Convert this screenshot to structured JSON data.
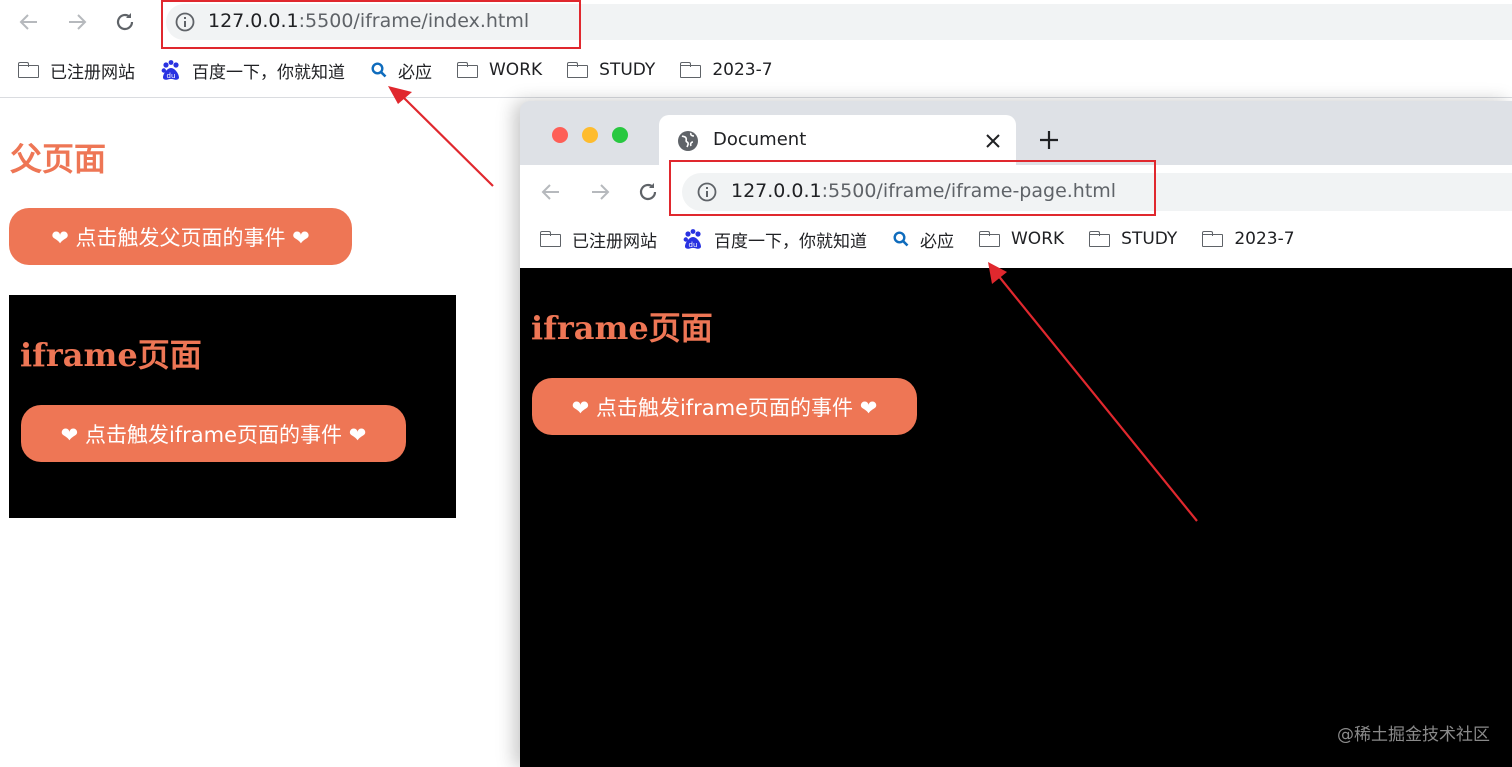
{
  "top_browser": {
    "url_host": "127.0.0.1",
    "url_path": ":5500/iframe/index.html",
    "bookmarks": [
      {
        "label": "已注册网站",
        "icon": "folder-icon"
      },
      {
        "label": "百度一下，你就知道",
        "icon": "baidu-paw-icon"
      },
      {
        "label": "必应",
        "icon": "bing-search-icon"
      },
      {
        "label": "WORK",
        "icon": "folder-icon"
      },
      {
        "label": "STUDY",
        "icon": "folder-icon"
      },
      {
        "label": "2023-7",
        "icon": "folder-icon"
      }
    ]
  },
  "parent_page": {
    "title": "父页面",
    "button_label": "❤ 点击触发父页面的事件 ❤",
    "embedded_iframe": {
      "title": "iframe页面",
      "button_label": "❤ 点击触发iframe页面的事件 ❤"
    }
  },
  "second_window": {
    "tab_title": "Document",
    "url_host": "127.0.0.1",
    "url_path": ":5500/iframe/iframe-page.html",
    "bookmarks": [
      {
        "label": "已注册网站",
        "icon": "folder-icon"
      },
      {
        "label": "百度一下，你就知道",
        "icon": "baidu-paw-icon"
      },
      {
        "label": "必应",
        "icon": "bing-search-icon"
      },
      {
        "label": "WORK",
        "icon": "folder-icon"
      },
      {
        "label": "STUDY",
        "icon": "folder-icon"
      },
      {
        "label": "2023-7",
        "icon": "folder-icon"
      }
    ],
    "page": {
      "title": "iframe页面",
      "button_label": "❤ 点击触发iframe页面的事件 ❤"
    }
  },
  "watermark": "@稀土掘金技术社区",
  "colors": {
    "accent": "#ee7655",
    "annotation_red": "#e0282e",
    "traffic_red": "#fe5f57",
    "traffic_yellow": "#febc2e",
    "traffic_green": "#28c840"
  }
}
